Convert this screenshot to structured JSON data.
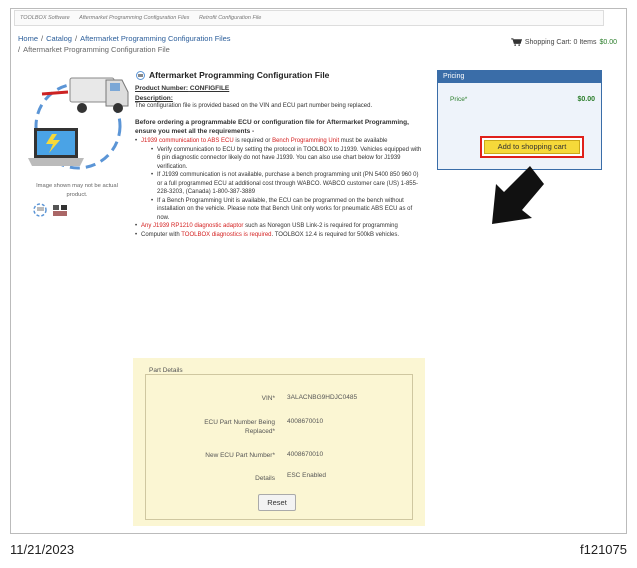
{
  "topnav": [
    "TOOLBOX Software",
    "Aftermarket Programming Configuration Files",
    "Retrofit Configuration File"
  ],
  "breadcrumb": {
    "home": "Home",
    "catalog": "Catalog",
    "section": "Aftermarket Programming Configuration Files",
    "current": "Aftermarket Programming Configuration File",
    "separator": "/"
  },
  "cart": {
    "label": "Shopping Cart: 0 Items",
    "amount": "$0.00",
    "icon": "shopping-cart-icon"
  },
  "product": {
    "image_note": "Image shown may not be actual product.",
    "title": "Aftermarket Programming Configuration File",
    "number_label": "Product Number:",
    "number_value": "CONFIGFILE",
    "description_heading": "Description:",
    "description": "The configuration file is provided based on the VIN and ECU part number being replaced.",
    "requirements_heading": "Before ordering a programmable ECU or configuration file for Aftermarket Programming, ensure you meet all the requirements -",
    "req1_red": "J1939 communication to ABS ECU",
    "req1_mid": " is required or ",
    "req1_red2": "Bench Programming Unit",
    "req1_end": " must be available",
    "sub1": "Verify communication to ECU by setting the protocol in TOOLBOX to J1939. Vehicles equipped with 6 pin diagnostic connector likely do not have J1939. You can also use chart below for J1939 verification.",
    "sub2": "If J1939 communication is not available, purchase a bench programming unit (PN 5400 850 960 0) or a full programmed ECU at additional cost through WABCO. WABCO customer care (US) 1-855-228-3203, (Canada) 1-800-387-3889",
    "sub3": "If a Bench Programming Unit is available, the ECU can be programmed on the bench without installation on the vehicle. Please note that Bench Unit only works for pneumatic ABS ECU as of now.",
    "req2_red": "Any J1939 RP1210 diagnostic adaptor",
    "req2_end": " such as Noregon USB Link-2 is required for programming",
    "req3_start": "Computer with ",
    "req3_red": "TOOLBOX diagnostics is required",
    "req3_end": ". TOOLBOX 12.4 is required for 500kB vehicles."
  },
  "pricing": {
    "heading": "Pricing",
    "price_label": "Price*",
    "price_value": "$0.00",
    "add_button": "Add to shopping cart",
    "highlight_color": "#e0201a"
  },
  "part_details": {
    "legend": "Part Details",
    "vin_label": "VIN*",
    "vin_value": "3ALACNBG9HDJC0485",
    "ecu_label": "ECU Part Number Being Replaced*",
    "ecu_value": "4008670010",
    "new_label": "New ECU Part Number*",
    "new_value": "4008670010",
    "details_label": "Details",
    "details_value": "ESC Enabled",
    "reset_button": "Reset"
  },
  "caption": {
    "date": "11/21/2023",
    "figure": "f121075"
  }
}
